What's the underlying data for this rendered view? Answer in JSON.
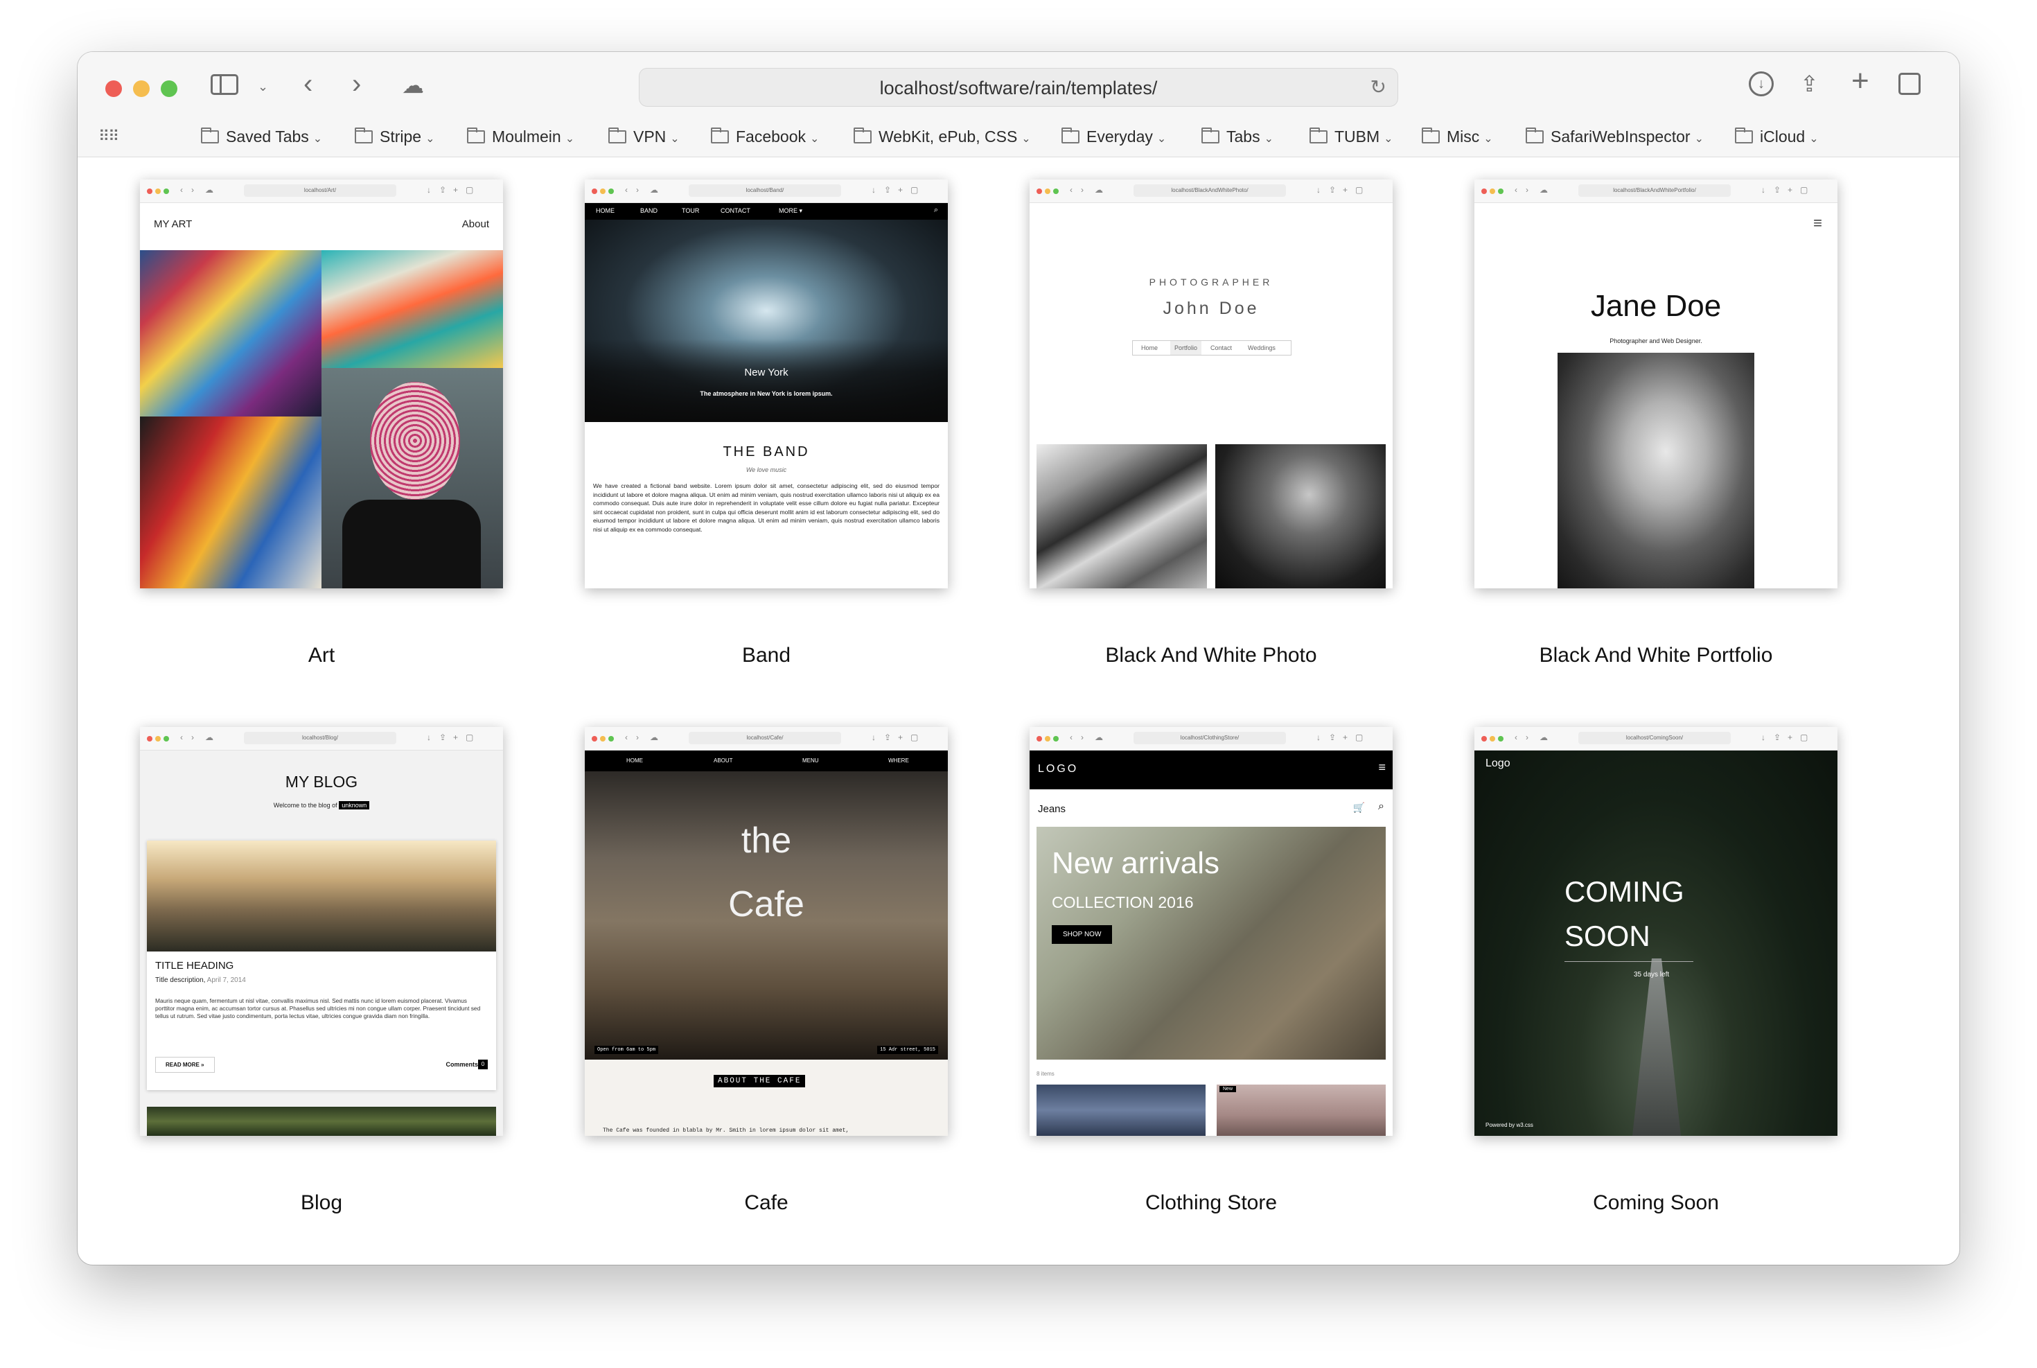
{
  "browser": {
    "address": "localhost/software/rain/templates/",
    "bookmarks": [
      {
        "label": "Saved Tabs"
      },
      {
        "label": "Stripe"
      },
      {
        "label": "Moulmein"
      },
      {
        "label": "VPN"
      },
      {
        "label": "Facebook"
      },
      {
        "label": "WebKit, ePub, CSS"
      },
      {
        "label": "Everyday"
      },
      {
        "label": "Tabs"
      },
      {
        "label": "TUBM"
      },
      {
        "label": "Misc"
      },
      {
        "label": "SafariWebInspector"
      },
      {
        "label": "iCloud"
      }
    ],
    "colors": {
      "close": "#ee5e56",
      "minimize": "#f5bd4f",
      "zoom": "#5fc451"
    }
  },
  "templates": [
    {
      "label": "Art",
      "url": "localhost/Art/"
    },
    {
      "label": "Band",
      "url": "localhost/Band/"
    },
    {
      "label": "Black And White Photo",
      "url": "localhost/BlackAndWhitePhoto/"
    },
    {
      "label": "Black And White Portfolio",
      "url": "localhost/BlackAndWhitePortfolio/"
    },
    {
      "label": "Blog",
      "url": "localhost/Blog/"
    },
    {
      "label": "Cafe",
      "url": "localhost/Cafe/"
    },
    {
      "label": "Clothing Store",
      "url": "localhost/ClothingStore/"
    },
    {
      "label": "Coming Soon",
      "url": "localhost/ComingSoon/"
    }
  ],
  "previews": {
    "art": {
      "brand": "MY ART",
      "nav": "About"
    },
    "band": {
      "nav": [
        "HOME",
        "BAND",
        "TOUR",
        "CONTACT",
        "MORE ▾"
      ],
      "hero_title": "New York",
      "hero_sub": "The atmosphere in New York is lorem ipsum.",
      "heading": "THE BAND",
      "tagline": "We love music",
      "body": "We have created a fictional band website. Lorem ipsum dolor sit amet, consectetur adipiscing elit, sed do eiusmod tempor incididunt ut labore et dolore magna aliqua. Ut enim ad minim veniam, quis nostrud exercitation ullamco laboris nisi ut aliquip ex ea commodo consequat. Duis aute irure dolor in reprehenderit in voluptate velit esse cillum dolore eu fugiat nulla pariatur. Excepteur sint occaecat cupidatat non proident, sunt in culpa qui officia deserunt mollit anim id est laborum consectetur adipiscing elit, sed do eiusmod tempor incididunt ut labore et dolore magna aliqua. Ut enim ad minim veniam, quis nostrud exercitation ullamco laboris nisi ut aliquip ex ea commodo consequat."
    },
    "bwphoto": {
      "kicker": "PHOTOGRAPHER",
      "name": "John Doe",
      "nav": [
        "Home",
        "Portfolio",
        "Contact",
        "Weddings"
      ]
    },
    "bwportfolio": {
      "name": "Jane Doe",
      "sub": "Photographer and Web Designer."
    },
    "blog": {
      "title": "MY BLOG",
      "welcome": "Welcome to the blog of",
      "badge": "unknown",
      "post_heading": "TITLE HEADING",
      "post_desc": "Title description,",
      "post_date": "April 7, 2014",
      "post_body": "Mauris neque quam, fermentum ut nisl vitae, convallis maximus nisl. Sed mattis nunc id lorem euismod placerat. Vivamus porttitor magna enim, ac accumsan tortor cursus at. Phasellus sed ultricies mi non congue ullam corper. Praesent tincidunt sed tellus ut rutrum. Sed vitae justo condimentum, porta lectus vitae, ultricies congue gravida diam non fringilla.",
      "read_more": "READ MORE »",
      "comments": "Comments",
      "comments_count": "0"
    },
    "cafe": {
      "nav": [
        "HOME",
        "ABOUT",
        "MENU",
        "WHERE"
      ],
      "title1": "the",
      "title2": "Cafe",
      "hours": "Open from 6am to 5pm",
      "address": "15 Adr street, 5015",
      "about": "ABOUT THE CAFE",
      "body": "The Cafe was founded in blabla by Mr. Smith in lorem ipsum dolor sit amet,"
    },
    "clothing": {
      "logo": "LOGO",
      "section": "Jeans",
      "hero1": "New arrivals",
      "hero2": "COLLECTION 2016",
      "cta": "SHOP NOW",
      "items": "8 items",
      "tag": "New"
    },
    "coming": {
      "logo": "Logo",
      "title1": "COMING",
      "title2": "SOON",
      "days": "35 days left",
      "powered": "Powered by w3.css"
    }
  }
}
